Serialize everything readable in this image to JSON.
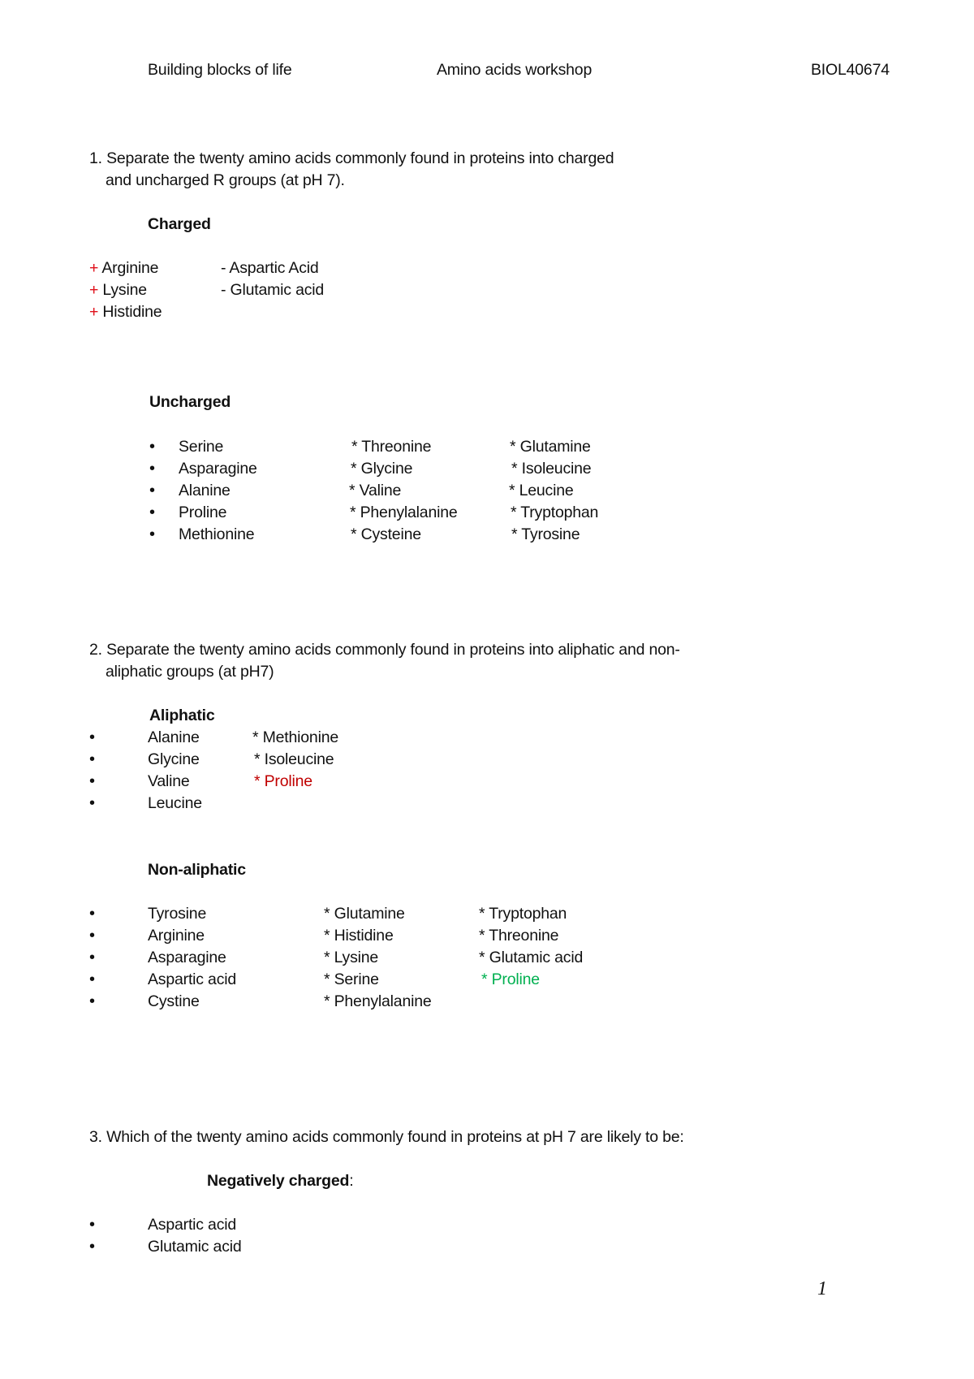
{
  "header": {
    "left": "Building blocks of life",
    "center": "Amino acids workshop",
    "right": "BIOL40674"
  },
  "q1": {
    "prompt_line1": "1. Separate the twenty amino acids commonly found in proteins into charged",
    "prompt_line2": "and uncharged R groups (at pH 7).",
    "charged": {
      "heading": "Charged",
      "positive_sign": "+",
      "positive": [
        "Arginine",
        "Lysine",
        "Histidine"
      ],
      "negative": [
        "- Aspartic Acid",
        "- Glutamic acid"
      ]
    },
    "uncharged": {
      "heading": "Uncharged",
      "col1": [
        "Serine",
        "Asparagine",
        "Alanine",
        "Proline",
        "Methionine"
      ],
      "col2": [
        "* Threonine",
        "* Glycine",
        "* Valine",
        "* Phenylalanine",
        "* Cysteine"
      ],
      "col3": [
        "* Glutamine",
        "* Isoleucine",
        "* Leucine",
        "* Tryptophan",
        "* Tyrosine"
      ]
    }
  },
  "q2": {
    "prompt_line1": "2. Separate the twenty amino acids commonly found in proteins into aliphatic and non-",
    "prompt_line2": "aliphatic groups (at pH7)",
    "aliphatic": {
      "heading": "Aliphatic",
      "col1": [
        "Alanine",
        "Glycine",
        "Valine",
        "Leucine"
      ],
      "col2": [
        "* Methionine",
        "* Isoleucine",
        "* Proline"
      ]
    },
    "non_aliphatic": {
      "heading": "Non-aliphatic",
      "col1": [
        "Tyrosine",
        "Arginine",
        "Asparagine",
        "Aspartic acid",
        "Cystine"
      ],
      "col2": [
        "* Glutamine",
        "* Histidine",
        "* Lysine",
        "* Serine",
        "* Phenylalanine"
      ],
      "col3": [
        "* Tryptophan",
        "* Threonine",
        "* Glutamic acid",
        "* Proline"
      ]
    }
  },
  "q3": {
    "prompt": "3. Which of the twenty amino acids commonly found in proteins at pH 7 are likely to be:",
    "negatively_charged": {
      "heading": "Negatively charged",
      "heading_suffix": ":",
      "items": [
        "Aspartic acid",
        "Glutamic acid"
      ]
    }
  },
  "footer": {
    "page_number": "1"
  },
  "colors": {
    "positive_sign": "#e0101a",
    "aliphatic_proline": "#c00000",
    "non_aliphatic_proline": "#00b050"
  }
}
